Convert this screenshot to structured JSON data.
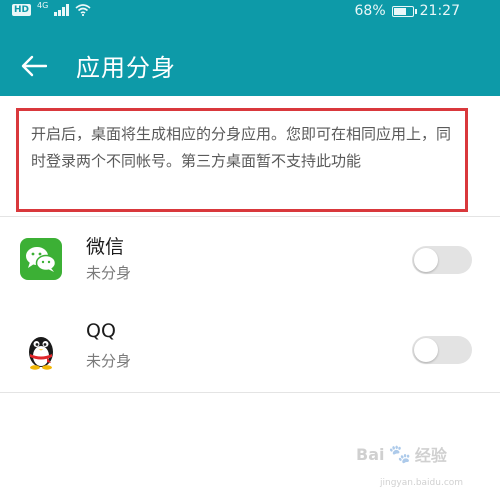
{
  "status_bar": {
    "hd_badge": "HD",
    "network": "4G",
    "battery": "68%",
    "battery_level": 0.68,
    "time": "21:27"
  },
  "header": {
    "title": "应用分身"
  },
  "notice": {
    "text": "开启后，桌面将生成相应的分身应用。您即可在相同应用上，同时登录两个不同帐号。第三方桌面暂不支持此功能"
  },
  "apps": [
    {
      "name": "微信",
      "status": "未分身",
      "enabled": false,
      "icon": "wechat-icon"
    },
    {
      "name": "QQ",
      "status": "未分身",
      "enabled": false,
      "icon": "qq-penguin-icon"
    }
  ],
  "watermark": {
    "text": "Bai",
    "text2": "经验",
    "sub": "jingyan.baidu.com"
  },
  "colors": {
    "header_bg": "#0d9aa8",
    "notice_border": "#d9383c",
    "wechat_green": "#3cb035"
  }
}
